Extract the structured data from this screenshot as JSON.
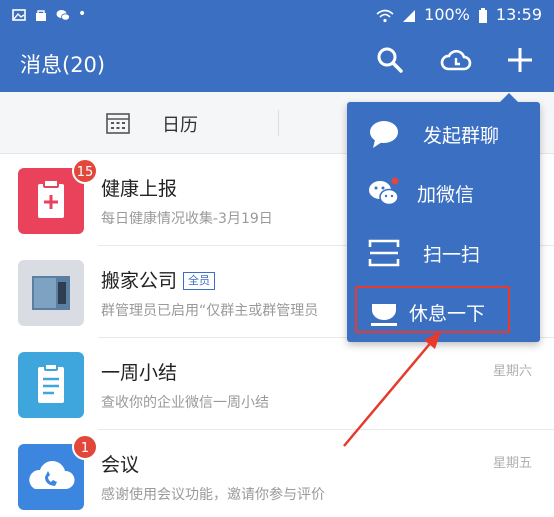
{
  "status_bar": {
    "battery": "100%",
    "time": "13:59"
  },
  "app_bar": {
    "title": "消息(20)",
    "icons": [
      "search-icon",
      "cloud-icon",
      "plus-icon"
    ]
  },
  "calendar_strip": {
    "label": "日历"
  },
  "conversations": [
    {
      "name": "健康上报",
      "tag": "",
      "preview": "每日健康情况收集-3月19日",
      "time": "",
      "badge": "15",
      "avatar_color": "#e9425a",
      "icon": "clipboard-plus-icon"
    },
    {
      "name": "搬家公司",
      "tag": "全员",
      "preview": "群管理员已启用“仅群主或群管理员",
      "time": "",
      "badge": "",
      "avatar_color": "#5b7fa0",
      "icon": "group-photo"
    },
    {
      "name": "一周小结",
      "tag": "",
      "preview": "查收你的企业微信一周小结",
      "time": "星期六",
      "badge": "",
      "avatar_color": "#3fa6dd",
      "icon": "report-icon"
    },
    {
      "name": "会议",
      "tag": "",
      "preview": "感谢使用会议功能，邀请你参与评价",
      "time": "星期五",
      "badge": "1",
      "avatar_color": "#3d86e0",
      "icon": "cloud-phone-icon"
    }
  ],
  "popup_menu": {
    "items": [
      {
        "label": "发起群聊",
        "icon": "chat-bubble-icon"
      },
      {
        "label": "加微信",
        "icon": "wechat-icon"
      },
      {
        "label": "扫一扫",
        "icon": "scan-icon"
      },
      {
        "label": "休息一下",
        "icon": "cup-icon"
      }
    ],
    "highlighted": "休息一下"
  },
  "colors": {
    "brand_blue": "#3b6fc2",
    "annotation_red": "#e63a2e",
    "badge_red": "#e2473c"
  }
}
